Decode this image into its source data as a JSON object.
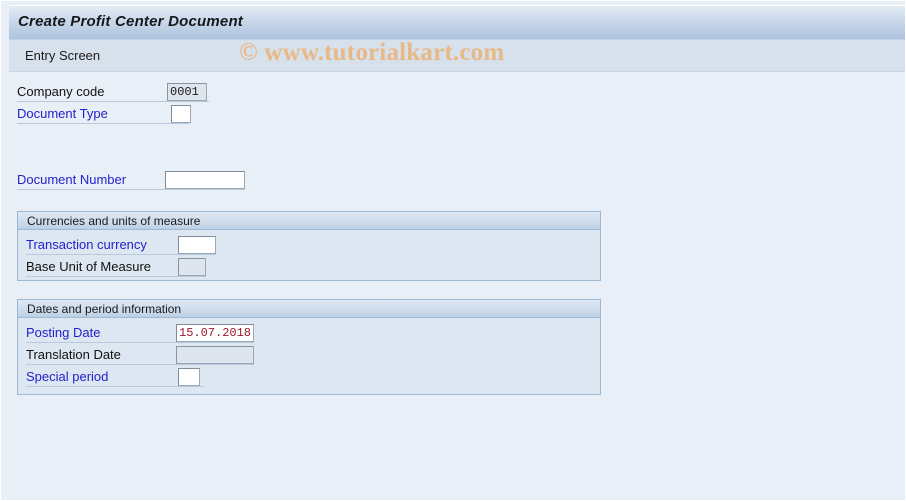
{
  "window": {
    "title": "Create Profit Center Document",
    "subtitle": "Entry Screen",
    "watermark": "© www.tutorialkart.com"
  },
  "top_fields": [
    {
      "label": "Company code",
      "value": "0001",
      "placeholder": "",
      "link": false,
      "readonly": true
    },
    {
      "label": "Document Type",
      "value": "",
      "placeholder": "",
      "link": true,
      "readonly": false
    },
    {
      "label": "Document Number",
      "value": "",
      "placeholder": "",
      "link": true,
      "readonly": false
    }
  ],
  "groups": [
    {
      "header": "Currencies and units of measure",
      "fields": [
        {
          "label": "Transaction currency",
          "value": "",
          "placeholder": "",
          "link": true,
          "readonly": false
        },
        {
          "label": "Base Unit of Measure",
          "value": "",
          "placeholder": "",
          "link": false,
          "readonly": true
        }
      ]
    },
    {
      "header": "Dates and period information",
      "fields": [
        {
          "label": "Posting Date",
          "value": "15.07.2018",
          "placeholder": "",
          "link": true,
          "readonly": false
        },
        {
          "label": "Translation Date",
          "value": "",
          "placeholder": "",
          "link": false,
          "readonly": true
        },
        {
          "label": "Special period",
          "value": "",
          "placeholder": "",
          "link": true,
          "readonly": false
        }
      ]
    }
  ],
  "colors": {
    "page_background": "#e9eff7",
    "title_gradient_top": "#e6edf6",
    "title_gradient_bottom": "#aec3de",
    "subband_background": "#d7e1ec",
    "group_body": "#dde7f1",
    "group_header_border": "#9fb8d4",
    "link_label": "#2222cc",
    "plain_label": "#121212",
    "date_value": "#9b1b2e",
    "watermark": "#e8b887",
    "readonly_field": "#dfe5ec"
  }
}
